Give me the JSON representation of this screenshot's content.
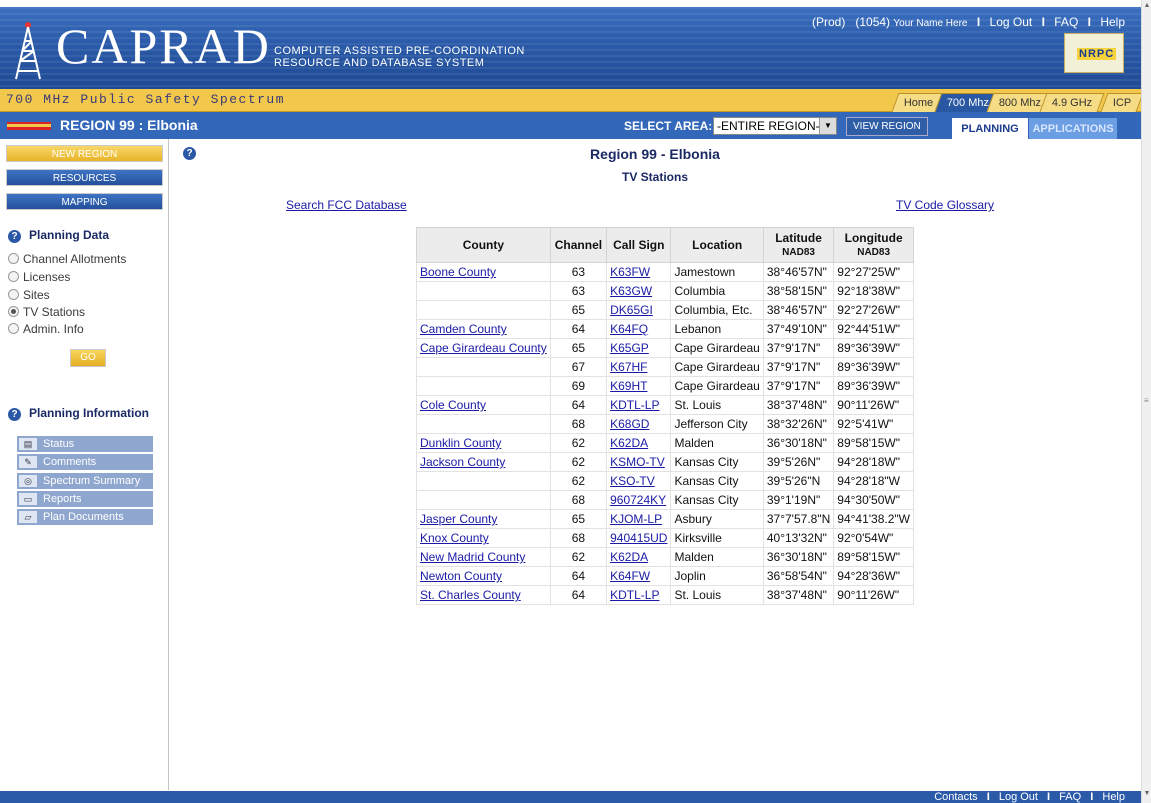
{
  "header": {
    "logo": "CAPRAD",
    "tagline_line1": "COMPUTER ASSISTED PRE-COORDINATION",
    "tagline_line2": "RESOURCE AND DATABASE SYSTEM",
    "badge": "NRPC",
    "top_links": {
      "env": "(Prod)",
      "user_id": "(1054)",
      "user_name": "Your Name Here",
      "logout": "Log Out",
      "faq": "FAQ",
      "help": "Help"
    }
  },
  "spectrum_bar": {
    "title": "700 MHz Public Safety Spectrum",
    "tabs": [
      "Home",
      "700 Mhz",
      "800 Mhz",
      "4.9 GHz",
      "ICP"
    ],
    "active_tab": "700 Mhz"
  },
  "region_bar": {
    "title": "REGION 99 : Elbonia",
    "select_area_label": "SELECT AREA:",
    "select_area_value": "-ENTIRE REGION-",
    "view_region_label": "VIEW REGION",
    "tabs": [
      "PLANNING",
      "APPLICATIONS"
    ],
    "active_tab": "PLANNING"
  },
  "sidebar": {
    "buttons": [
      "NEW REGION",
      "RESOURCES",
      "MAPPING"
    ],
    "planning_data_heading": "Planning Data",
    "planning_data_options": [
      "Channel Allotments",
      "Licenses",
      "Sites",
      "TV Stations",
      "Admin. Info"
    ],
    "selected_option": "TV Stations",
    "go_label": "GO",
    "planning_info_heading": "Planning Information",
    "planning_info_items": [
      "Status",
      "Comments",
      "Spectrum Summary",
      "Reports",
      "Plan Documents"
    ]
  },
  "main": {
    "title": "Region 99 - Elbonia",
    "subtitle": "TV Stations",
    "search_link": "Search FCC Database",
    "glossary_link": "TV Code Glossary",
    "table": {
      "headers": [
        "County",
        "Channel",
        "Call Sign",
        "Location",
        "Latitude",
        "Longitude"
      ],
      "header_subs": [
        "",
        "",
        "",
        "",
        "NAD83",
        "NAD83"
      ],
      "rows": [
        [
          "Boone County",
          "63",
          "K63FW",
          "Jamestown",
          "38°46'57N\"",
          "92°27'25W\""
        ],
        [
          "",
          "63",
          "K63GW",
          "Columbia",
          "38°58'15N\"",
          "92°18'38W\""
        ],
        [
          "",
          "65",
          "DK65GI",
          "Columbia, Etc.",
          "38°46'57N\"",
          "92°27'26W\""
        ],
        [
          "Camden County",
          "64",
          "K64FQ",
          "Lebanon",
          "37°49'10N\"",
          "92°44'51W\""
        ],
        [
          "Cape Girardeau County",
          "65",
          "K65GP",
          "Cape Girardeau",
          "37°9'17N\"",
          "89°36'39W\""
        ],
        [
          "",
          "67",
          "K67HF",
          "Cape Girardeau",
          "37°9'17N\"",
          "89°36'39W\""
        ],
        [
          "",
          "69",
          "K69HT",
          "Cape Girardeau",
          "37°9'17N\"",
          "89°36'39W\""
        ],
        [
          "Cole County",
          "64",
          "KDTL-LP",
          "St. Louis",
          "38°37'48N\"",
          "90°11'26W\""
        ],
        [
          "",
          "68",
          "K68GD",
          "Jefferson City",
          "38°32'26N\"",
          "92°5'41W\""
        ],
        [
          "Dunklin County",
          "62",
          "K62DA",
          "Malden",
          "36°30'18N\"",
          "89°58'15W\""
        ],
        [
          "Jackson County",
          "62",
          "KSMO-TV",
          "Kansas City",
          "39°5'26N\"",
          "94°28'18W\""
        ],
        [
          "",
          "62",
          "KSO-TV",
          "Kansas City",
          "39°5'26\"N",
          "94°28'18\"W"
        ],
        [
          "",
          "68",
          "960724KY",
          "Kansas City",
          "39°1'19N\"",
          "94°30'50W\""
        ],
        [
          "Jasper County",
          "65",
          "KJOM-LP",
          "Asbury",
          "37°7'57.8\"N",
          "94°41'38.2\"W"
        ],
        [
          "Knox County",
          "68",
          "940415UD",
          "Kirksville",
          "40°13'32N\"",
          "92°0'54W\""
        ],
        [
          "New Madrid County",
          "62",
          "K62DA",
          "Malden",
          "36°30'18N\"",
          "89°58'15W\""
        ],
        [
          "Newton County",
          "64",
          "K64FW",
          "Joplin",
          "36°58'54N\"",
          "94°28'36W\""
        ],
        [
          "St. Charles County",
          "64",
          "KDTL-LP",
          "St. Louis",
          "38°37'48N\"",
          "90°11'26W\""
        ]
      ]
    }
  },
  "footer": {
    "links": [
      "Contacts",
      "Log Out",
      "FAQ",
      "Help"
    ]
  },
  "colors": {
    "header_blue": "#2a5aa8",
    "spectrum_yellow": "#f1c84b",
    "link_blue": "#1a1aa6",
    "sidebar_item_blue": "#8fa6cf"
  }
}
